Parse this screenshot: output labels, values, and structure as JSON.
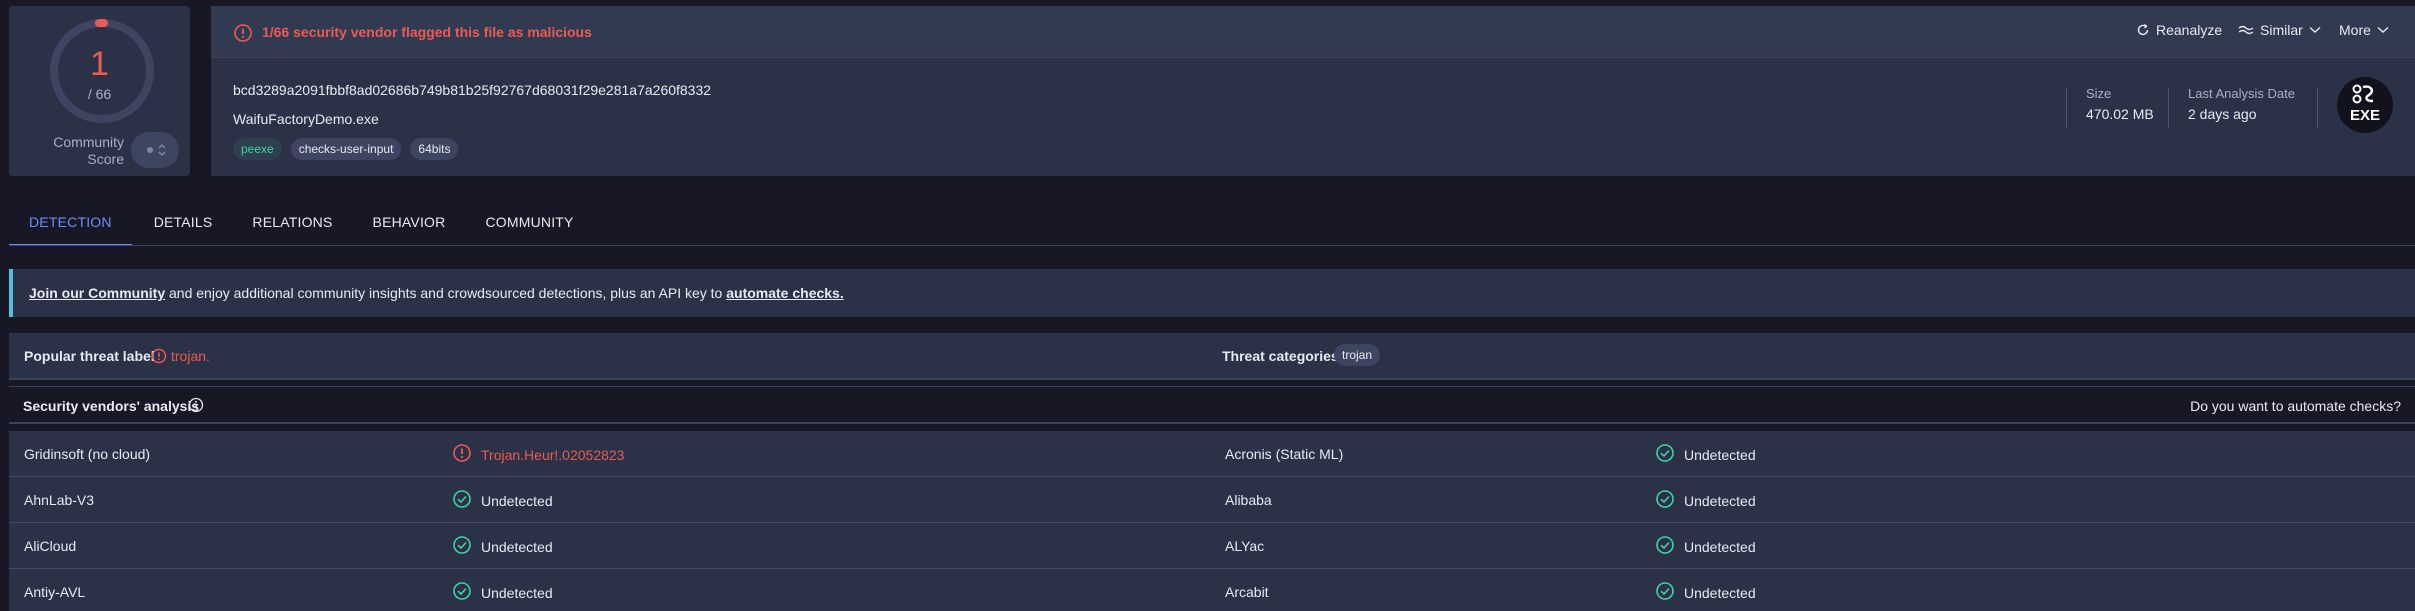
{
  "score": {
    "detections": "1",
    "total": "/ 66",
    "community_label": "Community Score"
  },
  "alert": {
    "text": "1/66 security vendor flagged this file as malicious"
  },
  "toolbar": {
    "reanalyze": "Reanalyze",
    "similar": "Similar",
    "more": "More"
  },
  "file": {
    "hash": "bcd3289a2091fbbf8ad02686b749b81b25f92767d68031f29e281a7a260f8332",
    "name": "WaifuFactoryDemo.exe",
    "tags": [
      "peexe",
      "checks-user-input",
      "64bits"
    ],
    "size_label": "Size",
    "size_value": "470.02 MB",
    "date_label": "Last Analysis Date",
    "date_value": "2 days ago",
    "type_badge": "EXE"
  },
  "tabs": [
    "DETECTION",
    "DETAILS",
    "RELATIONS",
    "BEHAVIOR",
    "COMMUNITY"
  ],
  "banner": {
    "join_link": "Join our Community",
    "middle_text": " and enjoy additional community insights and crowdsourced detections, plus an API key to ",
    "automate_link": "automate checks."
  },
  "threat": {
    "label": "Popular threat label",
    "value": "trojan.",
    "categories_label": "Threat categories",
    "category": "trojan"
  },
  "vendors": {
    "title": "Security vendors' analysis",
    "automate_question": "Do you want to automate checks?",
    "rows": [
      {
        "left_name": "Gridinsoft (no cloud)",
        "left_result": "Trojan.Heur!.02052823",
        "left_status": "malicious",
        "right_name": "Acronis (Static ML)",
        "right_result": "Undetected",
        "right_status": "undetected"
      },
      {
        "left_name": "AhnLab-V3",
        "left_result": "Undetected",
        "left_status": "undetected",
        "right_name": "Alibaba",
        "right_result": "Undetected",
        "right_status": "undetected"
      },
      {
        "left_name": "AliCloud",
        "left_result": "Undetected",
        "left_status": "undetected",
        "right_name": "ALYac",
        "right_result": "Undetected",
        "right_status": "undetected"
      },
      {
        "left_name": "Antiy-AVL",
        "left_result": "Undetected",
        "left_status": "undetected",
        "right_name": "Arcabit",
        "right_result": "Undetected",
        "right_status": "undetected"
      }
    ]
  },
  "colors": {
    "malicious": "#ea5b55",
    "clean": "#3fd4a2",
    "accent": "#6f8ef6"
  }
}
